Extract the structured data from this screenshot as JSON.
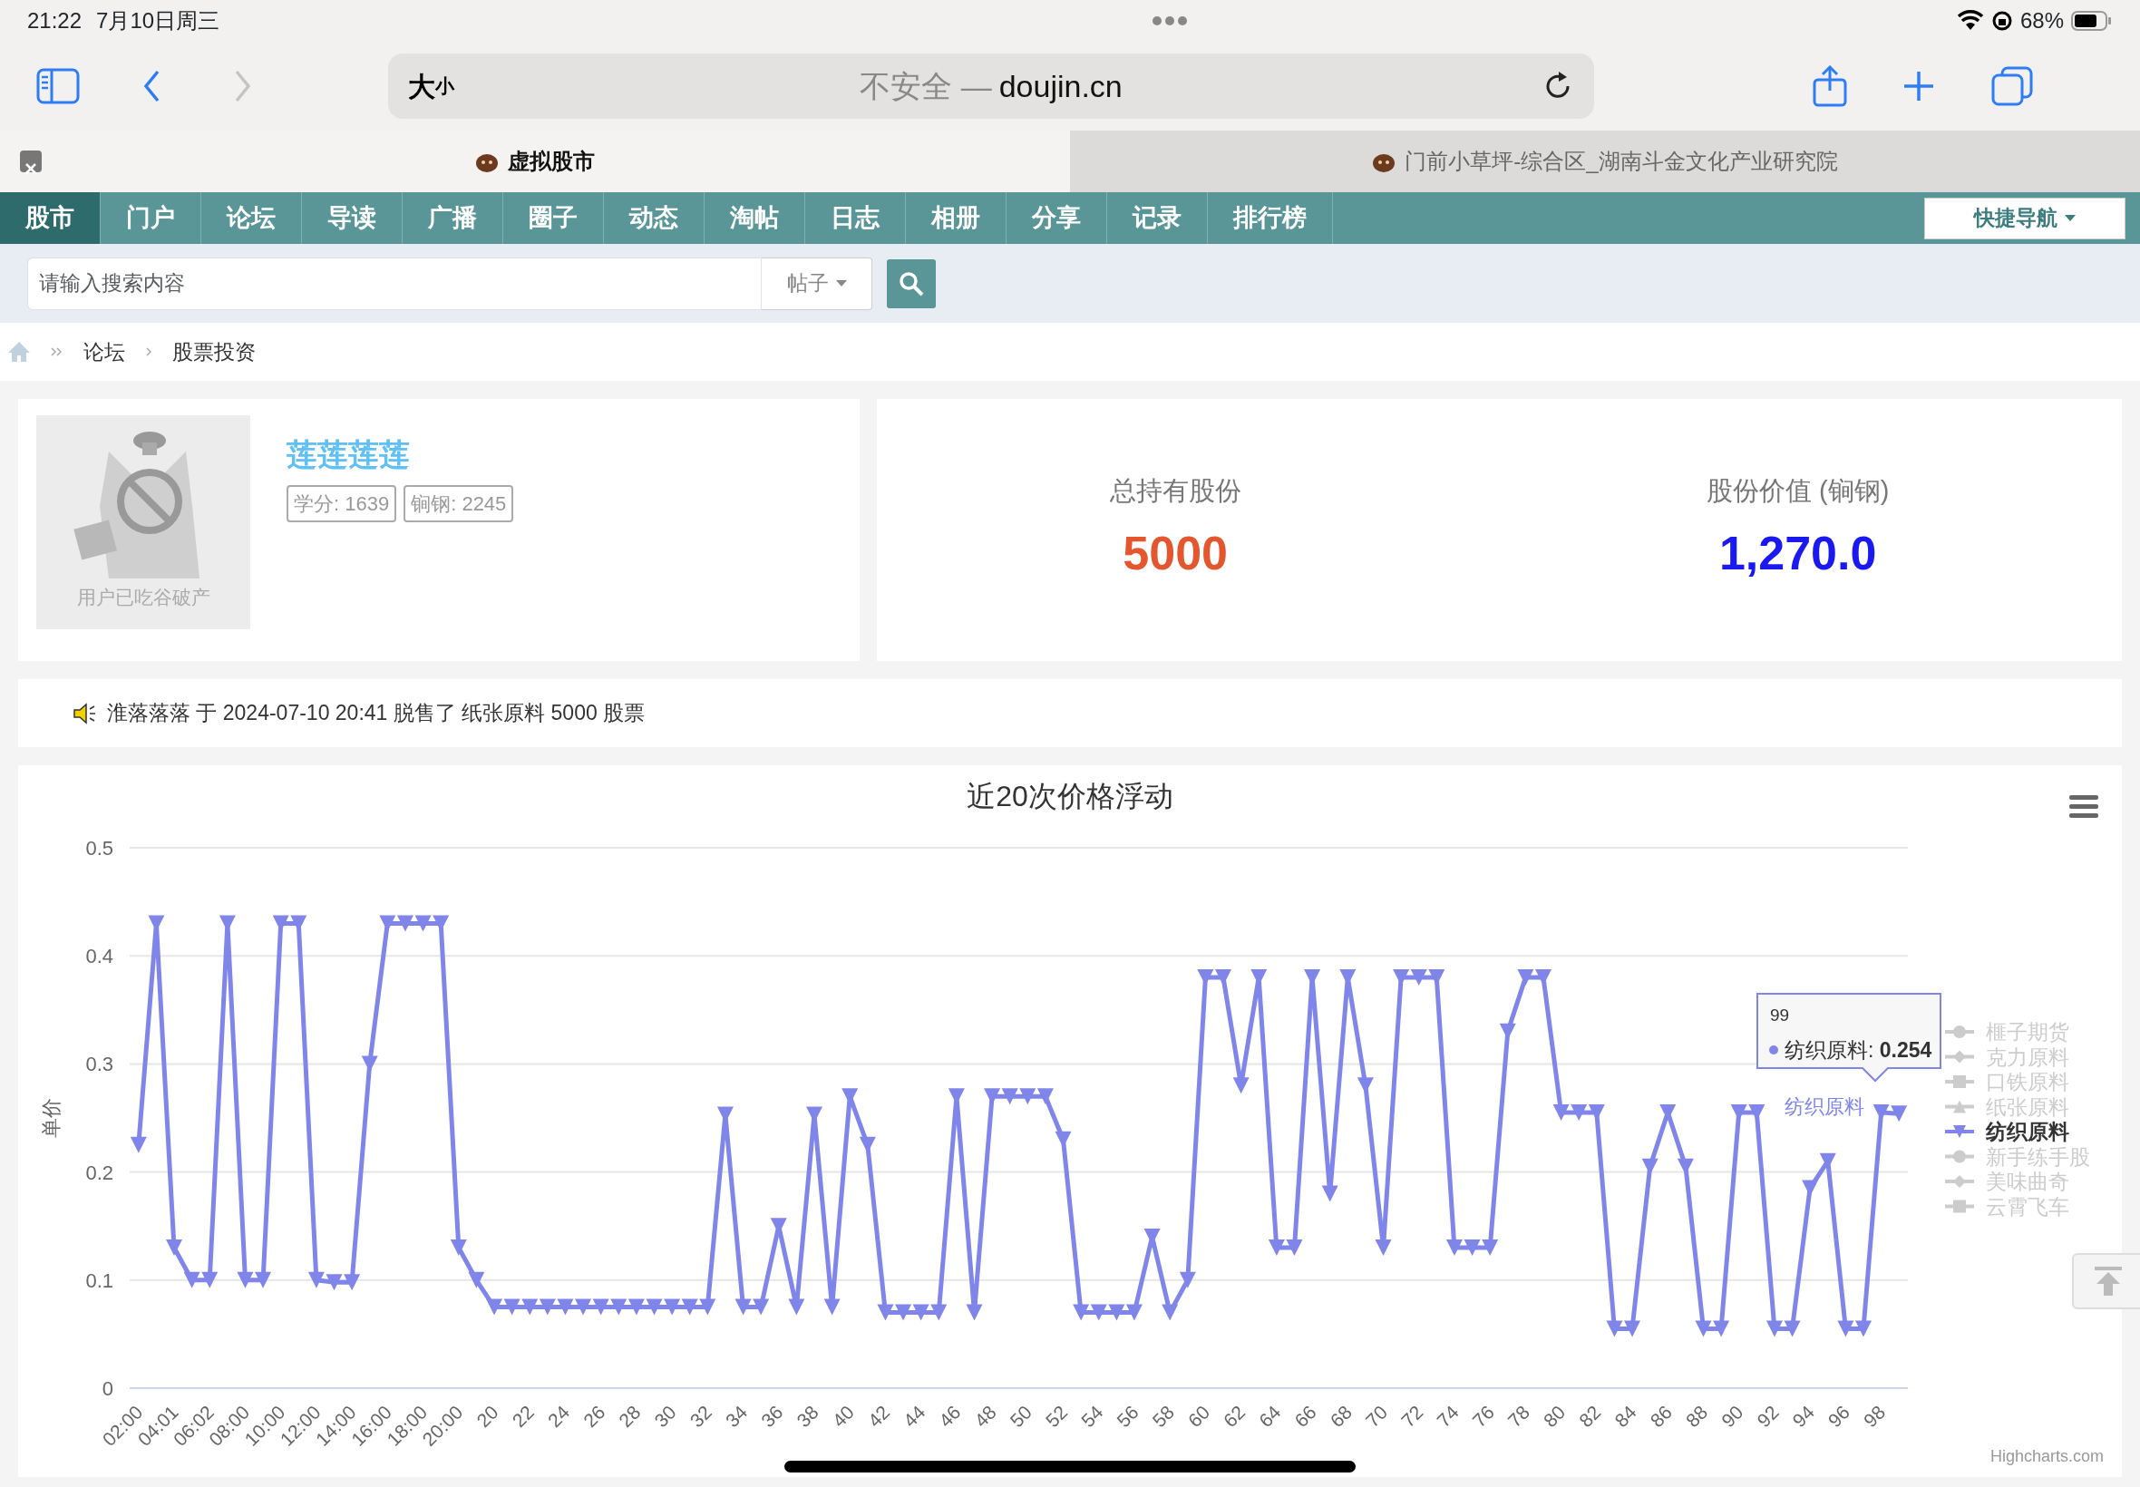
{
  "status_bar": {
    "time": "21:22",
    "date": "7月10日周三",
    "battery": "68%"
  },
  "browser": {
    "nav_buttons": [
      {
        "kind": "back",
        "disabled": false
      },
      {
        "kind": "forward",
        "disabled": true
      }
    ],
    "reader": {
      "large": "大",
      "small": "小"
    },
    "security": "不安全 —",
    "domain": "doujin.cn",
    "tabs": [
      {
        "title": "虚拟股市",
        "selected": true
      },
      {
        "title": "门前小草坪-综合区_湖南斗金文化产业研究院",
        "selected": false
      }
    ]
  },
  "site_nav": {
    "items": [
      {
        "label": "股市",
        "selected": true
      },
      {
        "label": "门户",
        "selected": false
      },
      {
        "label": "论坛",
        "selected": false
      },
      {
        "label": "导读",
        "selected": false
      },
      {
        "label": "广播",
        "selected": false
      },
      {
        "label": "圈子",
        "selected": false
      },
      {
        "label": "动态",
        "selected": false
      },
      {
        "label": "淘帖",
        "selected": false
      },
      {
        "label": "日志",
        "selected": false
      },
      {
        "label": "相册",
        "selected": false
      },
      {
        "label": "分享",
        "selected": false
      },
      {
        "label": "记录",
        "selected": false
      },
      {
        "label": "排行榜",
        "selected": false
      }
    ],
    "quick_nav": "快捷导航"
  },
  "search": {
    "placeholder": "请输入搜索内容",
    "scope": "帖子"
  },
  "breadcrumb": [
    "论坛",
    "股票投资"
  ],
  "profile": {
    "avatar_caption": "用户已吃谷破产",
    "name": "莲莲莲莲",
    "badges": [
      "学分: 1639",
      "锏钢: 2245"
    ]
  },
  "stats": [
    {
      "label": "总持有股份",
      "value": "5000",
      "color": "#e4572e"
    },
    {
      "label": "股份价值 (锏钢)",
      "value": "1,270.0",
      "color": "#1a1af0"
    }
  ],
  "notice": "淮落落落 于 2024-07-10 20:41 脱售了 纸张原料 5000 股票",
  "chart": {
    "chart_data": {
      "type": "line",
      "title": "近20次价格浮动",
      "ylabel": "单价",
      "categories": [
        "02:00",
        null,
        "04:01",
        null,
        "06:02",
        null,
        "08:00",
        null,
        "10:00",
        null,
        "12:00",
        null,
        "14:00",
        null,
        "16:00",
        null,
        "18:00",
        null,
        "20:00",
        null,
        "20",
        null,
        "22",
        null,
        "24",
        null,
        "26",
        null,
        "28",
        null,
        "30",
        null,
        "32",
        null,
        "34",
        null,
        "36",
        null,
        "38",
        null,
        "40",
        null,
        "42",
        null,
        "44",
        null,
        "46",
        null,
        "48",
        null,
        "50",
        null,
        "52",
        null,
        "54",
        null,
        "56",
        null,
        "58",
        null,
        "60",
        null,
        "62",
        null,
        "64",
        null,
        "66",
        null,
        "68",
        null,
        "70",
        null,
        "72",
        null,
        "74",
        null,
        "76",
        null,
        "78",
        null,
        "80",
        null,
        "82",
        null,
        "84",
        null,
        "86",
        null,
        "88",
        null,
        "90",
        null,
        "92",
        null,
        "94",
        null,
        "96",
        null,
        "98",
        null
      ],
      "grid": true,
      "series": [
        {
          "name": "纺织原料",
          "color": "#8085e9",
          "marker": "triangle-down",
          "values": [
            0.225,
            0.43,
            0.13,
            0.1,
            0.1,
            0.43,
            0.1,
            0.1,
            0.43,
            0.43,
            0.1,
            0.098,
            0.098,
            0.3,
            0.43,
            0.43,
            0.43,
            0.43,
            0.13,
            0.1,
            0.075,
            0.075,
            0.075,
            0.075,
            0.075,
            0.075,
            0.075,
            0.075,
            0.075,
            0.075,
            0.075,
            0.075,
            0.075,
            0.253,
            0.075,
            0.075,
            0.15,
            0.075,
            0.253,
            0.075,
            0.27,
            0.225,
            0.07,
            0.07,
            0.07,
            0.07,
            0.27,
            0.07,
            0.27,
            0.27,
            0.27,
            0.27,
            0.23,
            0.07,
            0.07,
            0.07,
            0.07,
            0.14,
            0.07,
            0.1,
            0.38,
            0.38,
            0.28,
            0.38,
            0.13,
            0.13,
            0.38,
            0.18,
            0.38,
            0.28,
            0.13,
            0.38,
            0.38,
            0.38,
            0.13,
            0.13,
            0.13,
            0.33,
            0.38,
            0.38,
            0.255,
            0.255,
            0.255,
            0.055,
            0.055,
            0.205,
            0.255,
            0.205,
            0.055,
            0.055,
            0.255,
            0.255,
            0.055,
            0.055,
            0.185,
            0.21,
            0.055,
            0.055,
            0.255,
            0.254
          ]
        }
      ],
      "ylim": [
        0,
        0.5
      ],
      "yticks": [
        0,
        0.1,
        0.2,
        0.3,
        0.4,
        0.5
      ]
    },
    "tooltip": {
      "header": "99",
      "label": "纺织原料:",
      "value": "0.254"
    },
    "legend": [
      {
        "label": "榧子期货",
        "kind": "circle",
        "visible": false
      },
      {
        "label": "克力原料",
        "kind": "diamond",
        "visible": false
      },
      {
        "label": "口铁原料",
        "kind": "square",
        "visible": false
      },
      {
        "label": "纸张原料",
        "kind": "triangle",
        "visible": false
      },
      {
        "label": "纺织原料",
        "kind": "triangle-down",
        "visible": true
      },
      {
        "label": "新手练手股",
        "kind": "circle",
        "visible": false
      },
      {
        "label": "美味曲奇",
        "kind": "diamond",
        "visible": false
      },
      {
        "label": "云霄飞车",
        "kind": "square",
        "visible": false
      }
    ],
    "credit": "Highcharts.com"
  }
}
